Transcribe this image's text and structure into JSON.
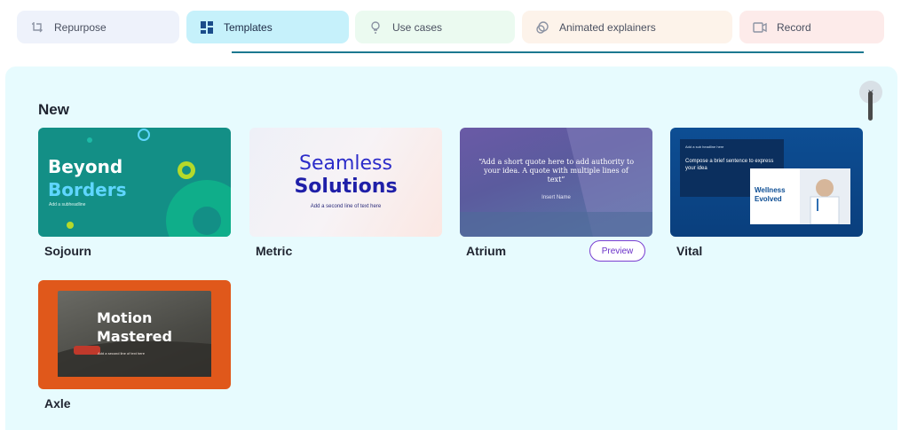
{
  "tabs": [
    {
      "label": "Repurpose",
      "icon": "repurpose-icon"
    },
    {
      "label": "Templates",
      "icon": "templates-grid-icon",
      "active": true
    },
    {
      "label": "Use cases",
      "icon": "lightbulb-icon"
    },
    {
      "label": "Animated explainers",
      "icon": "animation-icon"
    },
    {
      "label": "Record",
      "icon": "record-icon"
    }
  ],
  "section": {
    "title": "New"
  },
  "close": {
    "glyph": "×"
  },
  "templates": [
    {
      "name": "Sojourn",
      "line1": "Beyond",
      "line2": "Borders",
      "sub": "Add a subheadline",
      "colors": {
        "bg": "#138f86",
        "accent": "#5fd6ff"
      }
    },
    {
      "name": "Metric",
      "line1": "Seamless",
      "line2": "Solutions",
      "sub": "Add a second line of text here",
      "colors": {
        "title": "#2c2cc9"
      }
    },
    {
      "name": "Atrium",
      "quote": "“Add a short quote here to add authority to your idea. A quote with multiple lines of text”",
      "attribution": "Insert Name",
      "preview_label": "Preview"
    },
    {
      "name": "Vital",
      "kicker": "Add a sub headline here",
      "body": "Compose a brief sentence to express your idea",
      "card_title": "Wellness Evolved"
    },
    {
      "name": "Axle",
      "line1": "Motion",
      "line2": "Mastered",
      "sub": "Add a second line of text here",
      "colors": {
        "bg": "#e0581b"
      }
    }
  ],
  "colors": {
    "active_tab": "#c6f1fb",
    "indicator": "#1b7890",
    "panel_bg": "#e7fbfe",
    "preview_border": "#7a3fd1"
  }
}
